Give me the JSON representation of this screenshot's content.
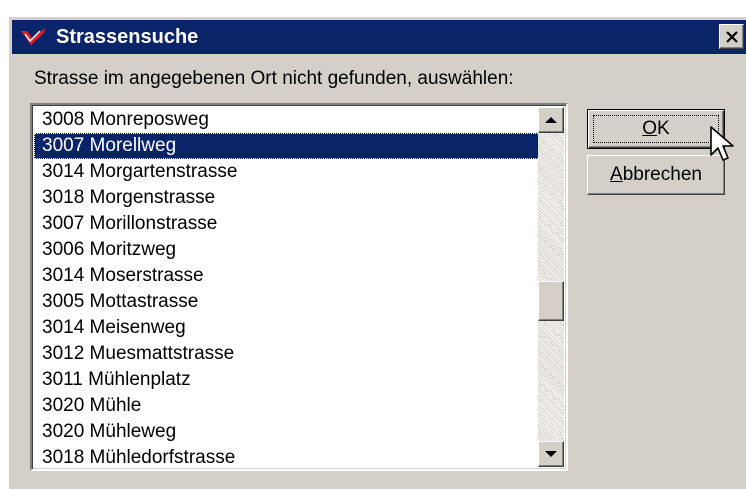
{
  "window": {
    "title": "Strassensuche",
    "accent_color": "#0a246a",
    "icon": "red-check-logo-icon",
    "close_icon": "close-icon"
  },
  "prompt": "Strasse im angegebenen Ort nicht gefunden, auswählen:",
  "streets": [
    {
      "label": "3008 Monreposweg",
      "selected": false
    },
    {
      "label": "3007 Morellweg",
      "selected": true
    },
    {
      "label": "3014 Morgartenstrasse",
      "selected": false
    },
    {
      "label": "3018 Morgenstrasse",
      "selected": false
    },
    {
      "label": "3007 Morillonstrasse",
      "selected": false
    },
    {
      "label": "3006 Moritzweg",
      "selected": false
    },
    {
      "label": "3014 Moserstrasse",
      "selected": false
    },
    {
      "label": "3005 Mottastrasse",
      "selected": false
    },
    {
      "label": "3014 Meisenweg",
      "selected": false
    },
    {
      "label": "3012 Muesmattstrasse",
      "selected": false
    },
    {
      "label": "3011 Mühlenplatz",
      "selected": false
    },
    {
      "label": "3020 Mühle",
      "selected": false
    },
    {
      "label": "3020 Mühleweg",
      "selected": false
    },
    {
      "label": "3018 Mühledorfstrasse",
      "selected": false
    }
  ],
  "buttons": {
    "ok": {
      "accel": "O",
      "rest": "K"
    },
    "cancel": {
      "accel": "A",
      "rest": "bbrechen"
    }
  }
}
